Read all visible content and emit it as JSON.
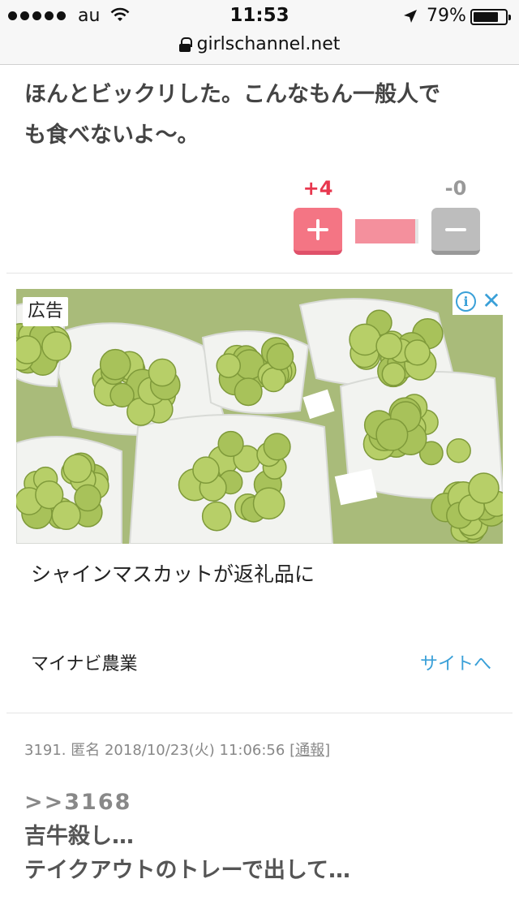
{
  "status_bar": {
    "carrier": "au",
    "time": "11:53",
    "battery_percent": "79%",
    "battery_level": 0.79
  },
  "url_bar": {
    "domain": "girlschannel.net"
  },
  "comment": {
    "body_line1": "ほんとビックリした。こんなもん一般人で",
    "body_line2": "も食べないよ〜。",
    "plus_count": "+4",
    "minus_count": "-0",
    "positive_ratio": 1.0
  },
  "ad": {
    "label": "広告",
    "info_icon": "i",
    "close_icon": "✕",
    "headline": "シャインマスカットが返礼品に",
    "advertiser": "マイナビ農業",
    "cta": "サイトへ"
  },
  "next_comment": {
    "meta": "3191. 匿名 2018/10/23(火) 11:06:56",
    "report": "[通報]",
    "reply_to": ">>3168",
    "line1": "吉牛殺し…",
    "line2": "テイクアウトのトレーで出して…"
  },
  "colors": {
    "plus": "#e8384f",
    "minus": "#999999",
    "link": "#3aa0d8"
  }
}
